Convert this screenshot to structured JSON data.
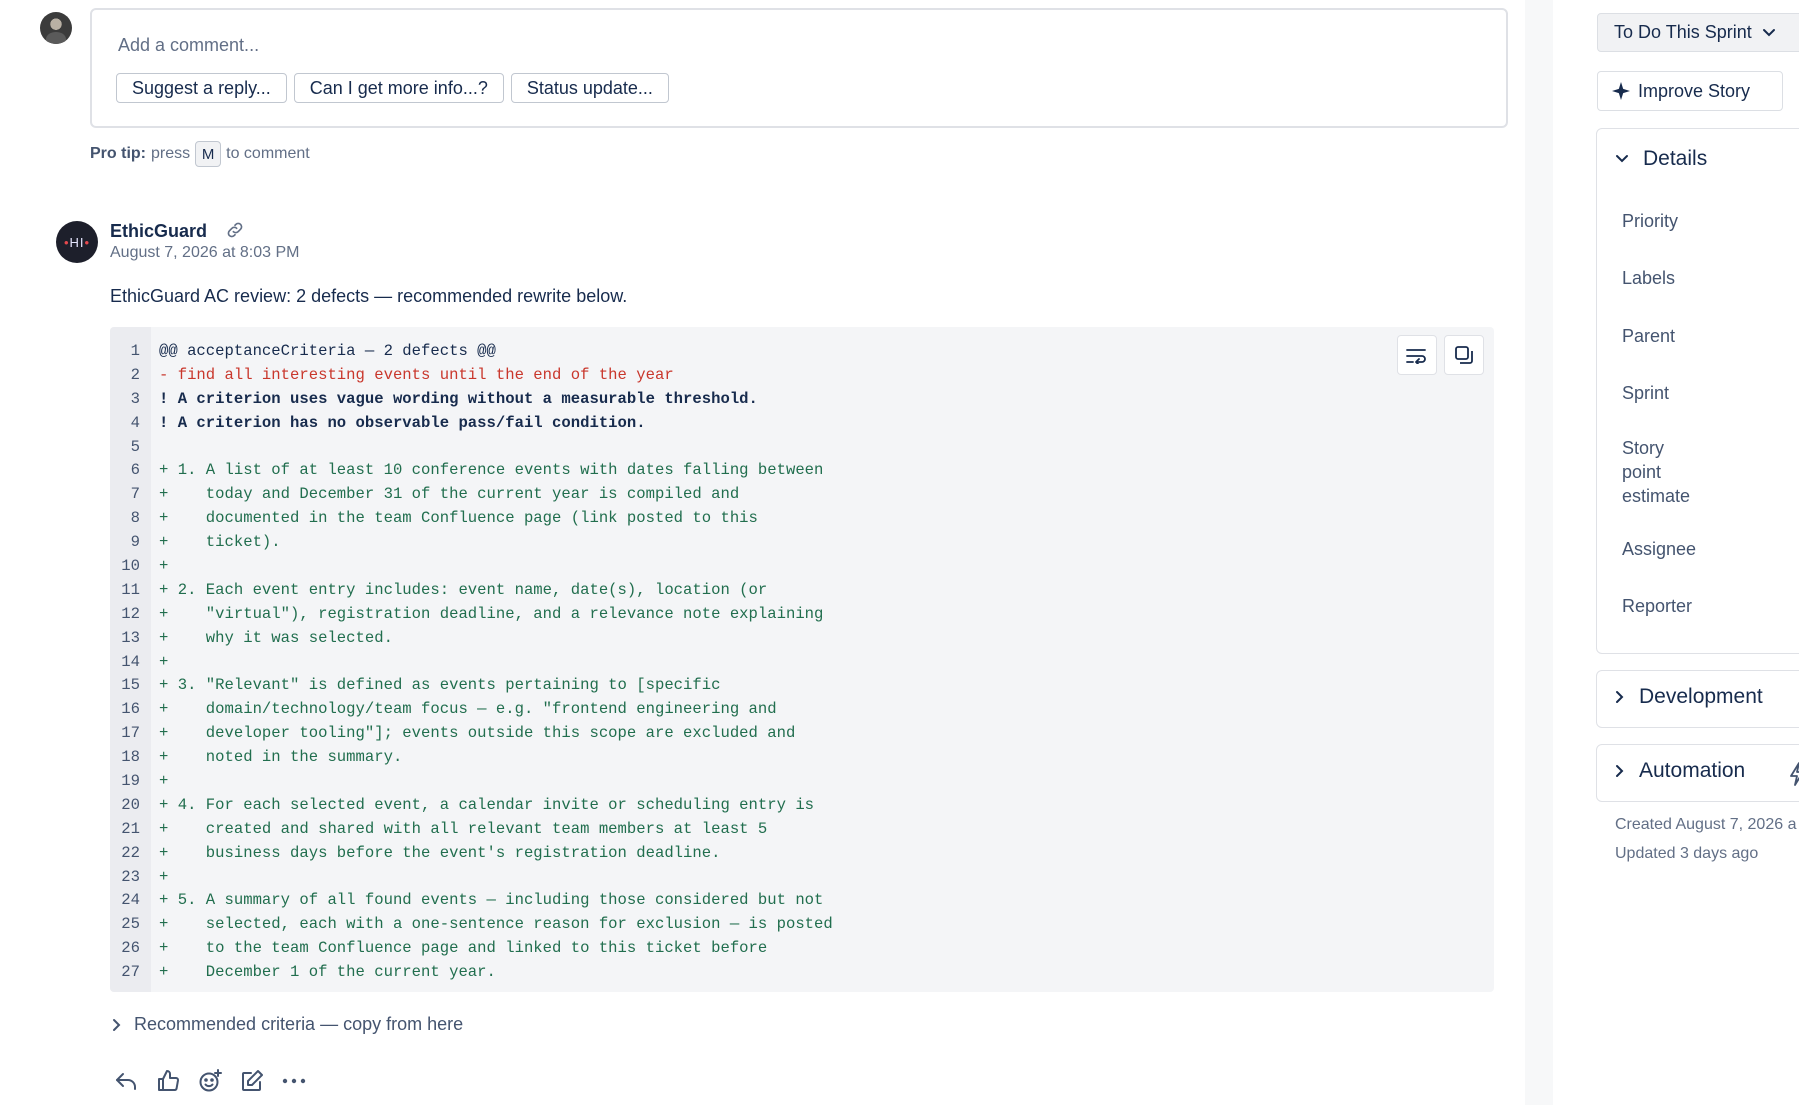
{
  "composer": {
    "placeholder": "Add a comment...",
    "suggestions": [
      "Suggest a reply...",
      "Can I get more info...?",
      "Status update..."
    ],
    "protip_label": "Pro tip:",
    "protip_press": "press",
    "protip_key": "M",
    "protip_rest": "to comment"
  },
  "comment": {
    "avatar_text_a": "HI",
    "author": "EthicGuard",
    "timestamp": "August 7, 2026 at 8:03 PM",
    "body": "EthicGuard AC review: 2 defects — recommended rewrite below.",
    "code_lines": [
      {
        "n": "1",
        "kind": "hdr",
        "text": "@@ acceptanceCriteria — 2 defects @@"
      },
      {
        "n": "2",
        "kind": "del",
        "text": "- find all interesting events until the end of the year"
      },
      {
        "n": "3",
        "kind": "warn",
        "text": "! A criterion uses vague wording without a measurable threshold."
      },
      {
        "n": "4",
        "kind": "warn",
        "text": "! A criterion has no observable pass/fail condition."
      },
      {
        "n": "5",
        "kind": "hdr",
        "text": ""
      },
      {
        "n": "6",
        "kind": "add",
        "text": "+ 1. A list of at least 10 conference events with dates falling between"
      },
      {
        "n": "7",
        "kind": "add",
        "text": "+    today and December 31 of the current year is compiled and"
      },
      {
        "n": "8",
        "kind": "add",
        "text": "+    documented in the team Confluence page (link posted to this"
      },
      {
        "n": "9",
        "kind": "add",
        "text": "+    ticket)."
      },
      {
        "n": "10",
        "kind": "add",
        "text": "+"
      },
      {
        "n": "11",
        "kind": "add",
        "text": "+ 2. Each event entry includes: event name, date(s), location (or"
      },
      {
        "n": "12",
        "kind": "add",
        "text": "+    \"virtual\"), registration deadline, and a relevance note explaining"
      },
      {
        "n": "13",
        "kind": "add",
        "text": "+    why it was selected."
      },
      {
        "n": "14",
        "kind": "add",
        "text": "+"
      },
      {
        "n": "15",
        "kind": "add",
        "text": "+ 3. \"Relevant\" is defined as events pertaining to [specific"
      },
      {
        "n": "16",
        "kind": "add",
        "text": "+    domain/technology/team focus — e.g. \"frontend engineering and"
      },
      {
        "n": "17",
        "kind": "add",
        "text": "+    developer tooling\"]; events outside this scope are excluded and"
      },
      {
        "n": "18",
        "kind": "add",
        "text": "+    noted in the summary."
      },
      {
        "n": "19",
        "kind": "add",
        "text": "+"
      },
      {
        "n": "20",
        "kind": "add",
        "text": "+ 4. For each selected event, a calendar invite or scheduling entry is"
      },
      {
        "n": "21",
        "kind": "add",
        "text": "+    created and shared with all relevant team members at least 5"
      },
      {
        "n": "22",
        "kind": "add",
        "text": "+    business days before the event's registration deadline."
      },
      {
        "n": "23",
        "kind": "add",
        "text": "+"
      },
      {
        "n": "24",
        "kind": "add",
        "text": "+ 5. A summary of all found events — including those considered but not"
      },
      {
        "n": "25",
        "kind": "add",
        "text": "+    selected, each with a one-sentence reason for exclusion — is posted"
      },
      {
        "n": "26",
        "kind": "add",
        "text": "+    to the team Confluence page and linked to this ticket before"
      },
      {
        "n": "27",
        "kind": "add",
        "text": "+    December 1 of the current year."
      }
    ],
    "recommended_label": "Recommended criteria — copy from here"
  },
  "sidebar": {
    "status": "To Do This Sprint",
    "improve": "Improve Story",
    "details_title": "Details",
    "fields": [
      "Priority",
      "Labels",
      "Parent",
      "Sprint",
      "Story\npoint\nestimate",
      "Assignee",
      "Reporter"
    ],
    "development_title": "Development",
    "automation_title": "Automation",
    "created": "Created August 7, 2026 a",
    "updated": "Updated 3 days ago"
  },
  "colors": {
    "deleted": "#c9372c",
    "added": "#216e4e",
    "scrollbar": "#a5adba"
  }
}
